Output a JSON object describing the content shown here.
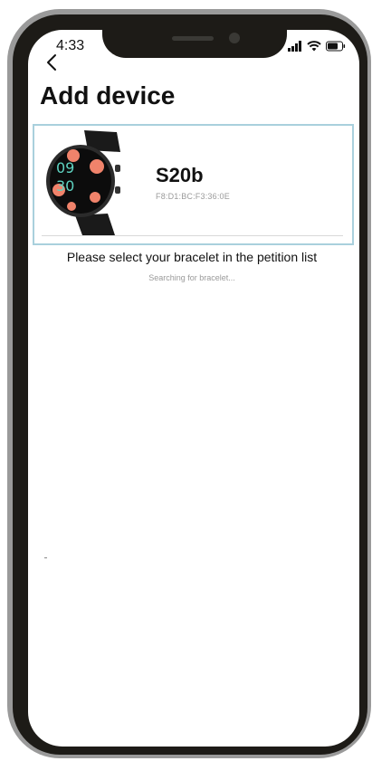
{
  "status_bar": {
    "time": "4:33",
    "icons": [
      "signal-icon",
      "wifi-icon",
      "battery-icon"
    ]
  },
  "header": {
    "back_icon": "chevron-left-icon",
    "title": "Add device"
  },
  "device": {
    "name": "S20b",
    "mac": "F8:D1:BC:F3:36:0E",
    "watch_face_time": [
      "09",
      "30"
    ]
  },
  "messages": {
    "instruction": "Please select your bracelet in the petition list",
    "searching": "Searching for bracelet..."
  },
  "colors": {
    "card_border": "#a9d0dd",
    "phone_frame": "#1d1b17",
    "watch_accent": "#f0836b"
  }
}
